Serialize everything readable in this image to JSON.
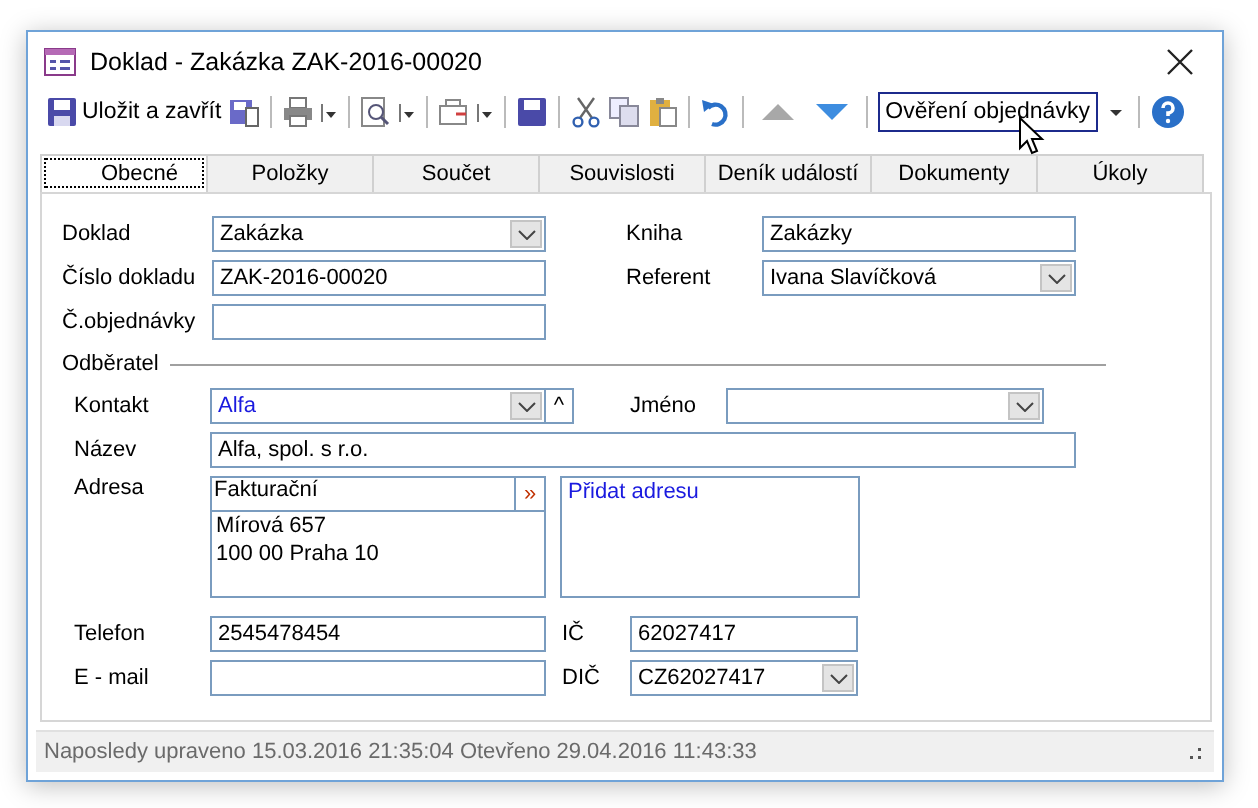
{
  "window": {
    "title": "Doklad - Zakázka ZAK-2016-00020"
  },
  "toolbar": {
    "save_close": "Uložit a zavřít",
    "previous_disabled": true,
    "next_disabled": false,
    "combo": {
      "value": "Ověření objednávky"
    }
  },
  "tabs": [
    {
      "label": "Obecné",
      "selected": true
    },
    {
      "label": "Položky",
      "selected": false
    },
    {
      "label": "Součet",
      "selected": false
    },
    {
      "label": "Souvislosti",
      "selected": false
    },
    {
      "label": "Deník událostí",
      "selected": false
    },
    {
      "label": "Dokumenty",
      "selected": false
    },
    {
      "label": "Úkoly",
      "selected": false
    }
  ],
  "document": {
    "doklad": {
      "label": "Doklad",
      "kind": "combo",
      "value": "Zakázka"
    },
    "cislo": {
      "label": "Číslo dokladu",
      "kind": "text",
      "value": "ZAK-2016-00020"
    },
    "objednavka": {
      "label": "Č.objednávky",
      "kind": "text"
    },
    "kniha": {
      "label": "Kniha",
      "kind": "text",
      "value": "Zakázky"
    },
    "referent": {
      "label": "Referent",
      "kind": "combo",
      "value": "Ivana Slavíčková"
    }
  },
  "customer": {
    "title": "Odběratel",
    "kontakt": {
      "label": "Kontakt",
      "kind": "combo",
      "value": "Alfa",
      "collapse": "^"
    },
    "jmeno": {
      "label": "Jméno",
      "kind": "combo"
    },
    "nazev": {
      "label": "Název",
      "kind": "text",
      "value": "Alfa, spol. s r.o."
    },
    "adresa": {
      "label": "Adresa",
      "type": "Fakturační",
      "button": "»",
      "lines": [
        "Mírová 657",
        "100 00 Praha 10"
      ],
      "add_link": "Přidat adresu"
    },
    "telefon": {
      "label": "Telefon",
      "kind": "text",
      "value": "2545478454"
    },
    "ic": {
      "label": "IČ",
      "kind": "text",
      "value": "62027417"
    },
    "email": {
      "label": "E - mail",
      "kind": "text"
    },
    "dic": {
      "label": "DIČ",
      "kind": "combo",
      "value": "CZ62027417"
    }
  },
  "status_bar": {
    "text": "Naposledy upraveno 15.03.2016 21:35:04 Otevřeno 29.04.2016 11:43:33"
  }
}
